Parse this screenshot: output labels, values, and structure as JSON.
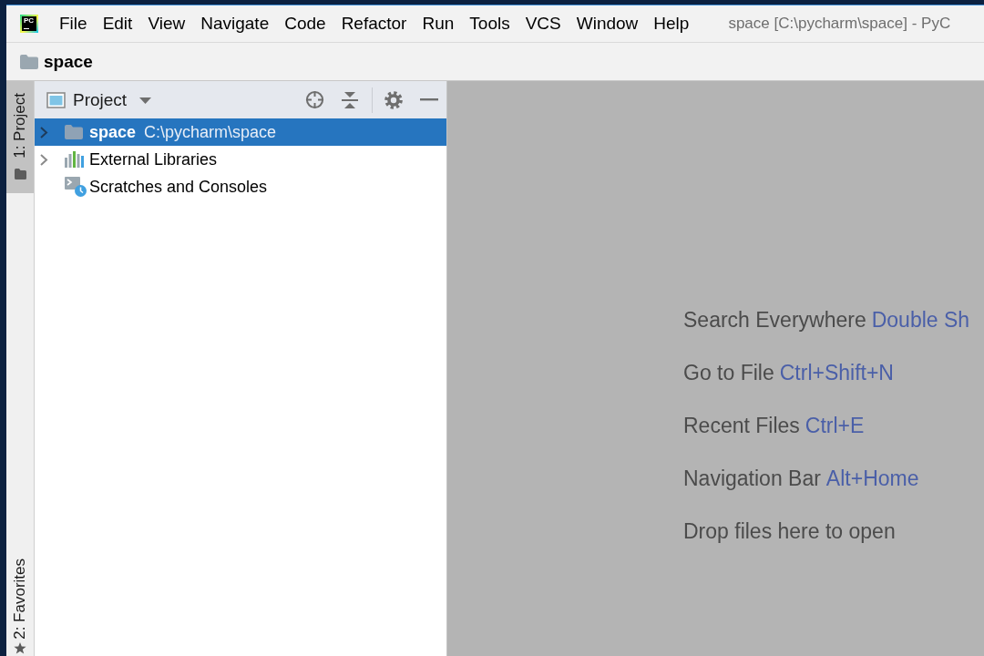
{
  "window": {
    "title": "space [C:\\pycharm\\space] - PyC",
    "logo": "PC"
  },
  "menu": [
    "File",
    "Edit",
    "View",
    "Navigate",
    "Code",
    "Refactor",
    "Run",
    "Tools",
    "VCS",
    "Window",
    "Help"
  ],
  "navigation_bar": {
    "crumbs": [
      "space"
    ]
  },
  "tool_strip": {
    "top": [
      {
        "label": "1: Project",
        "selected": true
      }
    ],
    "bottom": [
      {
        "label": "2: Favorites",
        "selected": false
      }
    ]
  },
  "project_panel": {
    "title": "Project",
    "tree": [
      {
        "kind": "folder",
        "name": "space",
        "path": "C:\\pycharm\\space",
        "selected": true,
        "expanded": false
      },
      {
        "kind": "libraries",
        "name": "External Libraries",
        "selected": false,
        "expanded": false
      },
      {
        "kind": "scratches",
        "name": "Scratches and Consoles",
        "selected": false
      }
    ]
  },
  "editor": {
    "hints": [
      {
        "action": "Search Everywhere",
        "shortcut": "Double Sh"
      },
      {
        "action": "Go to File",
        "shortcut": "Ctrl+Shift+N"
      },
      {
        "action": "Recent Files",
        "shortcut": "Ctrl+E"
      },
      {
        "action": "Navigation Bar",
        "shortcut": "Alt+Home"
      },
      {
        "action": "Drop files here to open"
      }
    ]
  }
}
